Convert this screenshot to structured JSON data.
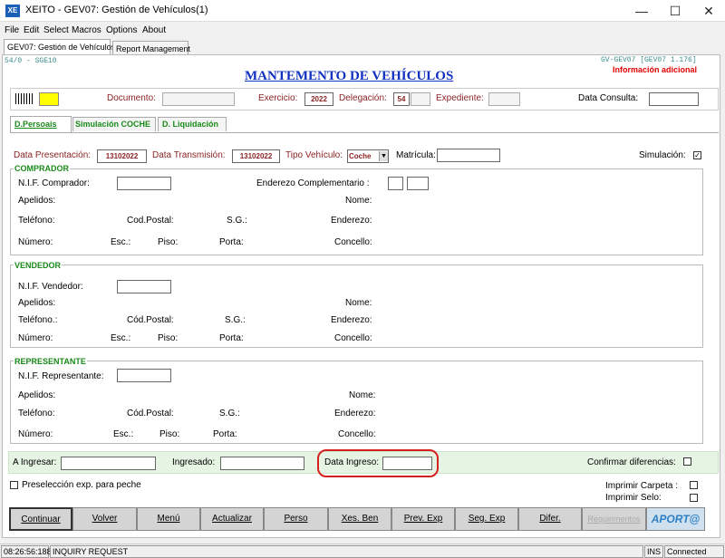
{
  "window": {
    "title": "XEITO - GEV07: Gestión de Vehículos(1)",
    "icon_text": "XE"
  },
  "menu": [
    "File",
    "Edit",
    "Select",
    "Macros",
    "Options",
    "About"
  ],
  "doc_tabs": [
    "GEV07: Gestión de Vehículos",
    "Report Management"
  ],
  "header": {
    "left_code": "54/0 - SGE10",
    "right_code": "GV-GEV07 [GEV07 1.176]",
    "title": "MANTEMENTO DE VEHÍCULOS",
    "additional": "Información adicional"
  },
  "topbar": {
    "documento": "Documento:",
    "ejercicio_label": "Exercicio:",
    "ejercicio": "2022",
    "delegacion_label": "Delegación:",
    "delegacion": "54",
    "expediente": "Expediente:",
    "data_consulta": "Data Consulta:"
  },
  "subtabs": [
    "D.Persoais",
    "Simulación COCHE",
    "D. Liquidación"
  ],
  "row1": {
    "data_presentacion_label": "Data Presentación:",
    "data_presentacion": "13102022",
    "data_transmision_label": "Data Transmisión:",
    "data_transmision": "13102022",
    "tipo_vehiculo_label": "Tipo Vehículo:",
    "tipo_vehiculo": "Coche",
    "matricula_label": "Matrícula:",
    "simulacion_label": "Simulación:"
  },
  "comprador": {
    "title": "COMPRADOR",
    "nif": "N.I.F.  Comprador:",
    "enderezo_comp": "Enderezo Complementario :",
    "apelidos": "Apelidos:",
    "nome": "Nome:",
    "telefono": "Teléfono:",
    "cod_postal": "Cod.Postal:",
    "sg": "S.G.:",
    "enderezo": "Enderezo:",
    "numero": "Número:",
    "esc": "Esc.:",
    "piso": "Piso:",
    "porta": "Porta:",
    "concello": "Concello:"
  },
  "vendedor": {
    "title": "VENDEDOR",
    "nif": "N.I.F.  Vendedor:",
    "apelidos": "Apelidos:",
    "nome": "Nome:",
    "telefono": "Teléfono.:",
    "cod_postal": "Cód.Postal:",
    "sg": "S.G.:",
    "enderezo": "Enderezo:",
    "numero": "Número:",
    "esc": "Esc.:",
    "piso": "Piso:",
    "porta": "Porta:",
    "concello": "Concello:"
  },
  "representante": {
    "title": "REPRESENTANTE",
    "nif": "N.I.F.  Representante:",
    "apelidos": "Apelidos:",
    "nome": "Nome:",
    "telefono": "Teléfono:",
    "cod_postal": "Cód.Postal:",
    "sg": "S.G.:",
    "enderezo": "Enderezo:",
    "numero": "Número:",
    "esc": "Esc.:",
    "piso": "Piso:",
    "porta": "Porta:",
    "concello": "Concello:"
  },
  "bottom": {
    "a_ingresar": "A Ingresar:",
    "ingresado": "Ingresado:",
    "data_ingreso": "Data Ingreso:",
    "confirmar": "Confirmar diferencias:",
    "preseleccion": "Preselección exp. para peche",
    "imprimir_carpeta": "Imprimir Carpeta :",
    "imprimir_selo": "Imprimir Selo:"
  },
  "buttons": [
    "Continuar",
    "Volver",
    "Menú",
    "Actualizar",
    "Perso",
    "Xes. Ben",
    "Prev. Exp",
    "Seg. Exp",
    "Difer.",
    "Requirimentos"
  ],
  "aporta": "APORT@",
  "status": {
    "time": "08:26:56:188",
    "mode": "INQUIRY REQUEST",
    "ins": "INS",
    "conn": "Connected"
  },
  "colors": {
    "accent": "#1030c0",
    "label_red": "#8b2323",
    "group_green": "#1a8a1a",
    "highlight": "#e00000"
  }
}
